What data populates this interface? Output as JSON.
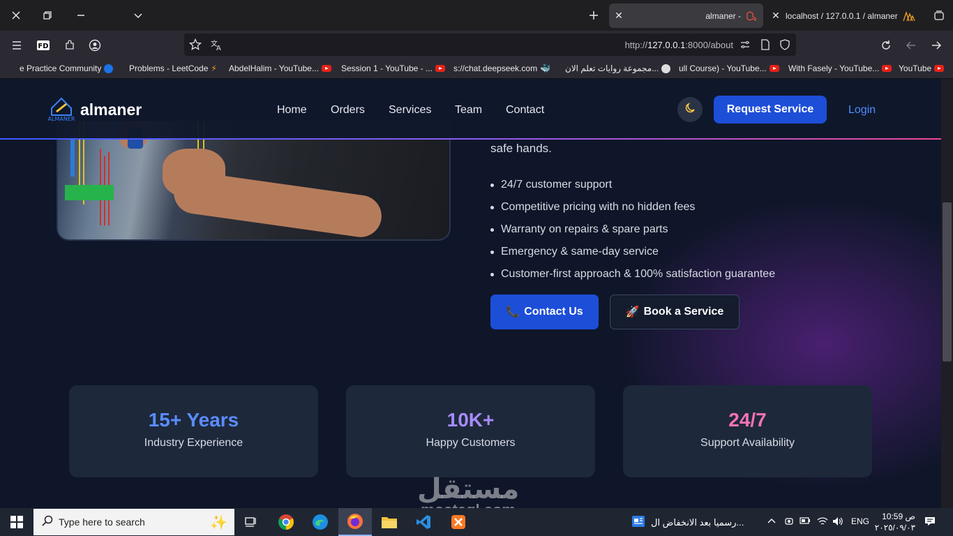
{
  "browser": {
    "tabs": [
      {
        "title": "almaner -",
        "active": true
      },
      {
        "title": "localhost / 127.0.0.1 / almaner",
        "active": false
      }
    ],
    "url": {
      "prefix": "http://",
      "host": "127.0.0.1",
      "rest": ":8000/about"
    },
    "bookmarks": [
      "e Practice Community",
      "Problems - LeetCode",
      "AbdelHalim - YouTube...",
      "Session 1 - YouTube - ...",
      "s://chat.deepseek.com",
      "مجموعة روايات تعلم الان...",
      "ull Course) - YouTube...",
      "With Fasely - YouTube...",
      "YouTube"
    ]
  },
  "site": {
    "brand": {
      "name": "almaner",
      "logo_caption": "ALMANER"
    },
    "nav": [
      "Home",
      "Orders",
      "Services",
      "Team",
      "Contact"
    ],
    "request_button": "Request Service",
    "login": "Login",
    "intro_tail": "safe hands.",
    "features": [
      "24/7 customer support",
      "Competitive pricing with no hidden fees",
      "Warranty on repairs & spare parts",
      "Emergency & same-day service",
      "Customer-first approach & 100% satisfaction guarantee"
    ],
    "buttons": {
      "contact": "Contact Us",
      "contact_emoji": "📞",
      "book": "Book a Service",
      "book_emoji": "🚀"
    },
    "stats": [
      {
        "value": "15+ Years",
        "label": "Industry Experience",
        "color": "#5b8cff"
      },
      {
        "value": "10K+",
        "label": "Happy Customers",
        "color": "#a78bfa"
      },
      {
        "value": "24/7",
        "label": "Support Availability",
        "color": "#f472b6"
      }
    ]
  },
  "watermark": {
    "arabic": "مستقل",
    "latin": "mostaql.com"
  },
  "taskbar": {
    "search_placeholder": "Type here to search",
    "news": "رسميا بعد الانخفاض ال...",
    "language": "ENG",
    "time": "10:59 ص",
    "date": "٢٠٢٥/٠٩/٠٣"
  }
}
